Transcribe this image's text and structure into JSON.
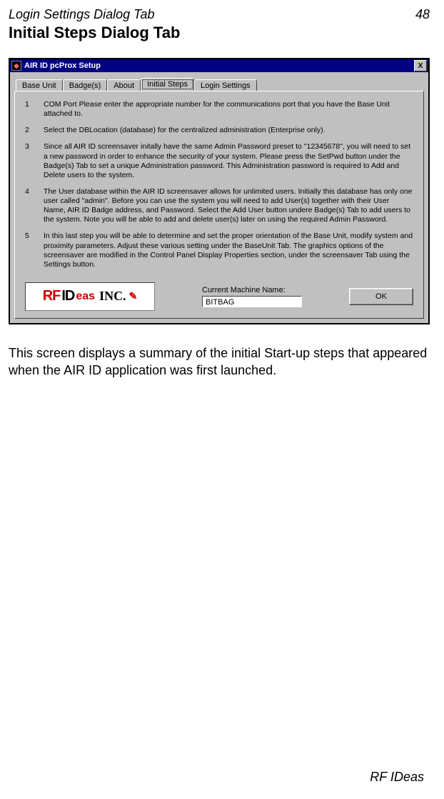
{
  "header": {
    "left": "Login Settings Dialog Tab",
    "right": "48"
  },
  "title": "Initial Steps Dialog Tab",
  "window": {
    "title": "AIR ID pcProx Setup",
    "close_glyph": "X",
    "tabs": [
      {
        "label": "Base Unit"
      },
      {
        "label": "Badge(s)"
      },
      {
        "label": "About"
      },
      {
        "label": "Initial Steps"
      },
      {
        "label": "Login Settings"
      }
    ],
    "active_tab_index": 3,
    "steps": [
      {
        "n": "1",
        "text": "COM Port   Please enter the appropriate number for the communications port that you have the Base Unit attached to."
      },
      {
        "n": "2",
        "text": "Select the DBLocation (database) for the centralized administration (Enterprise only)."
      },
      {
        "n": "3",
        "text": "Since all AIR ID screensaver initally have the same Admin Password preset to \"12345678\", you will need to set a new password in order to enhance the security of your system.  Please press the SetPwd button under the Badge(s) Tab to set a unique Administration password.  This Administration password is required to Add and Delete users to the system."
      },
      {
        "n": "4",
        "text": "The User database within the AIR ID screensaver allows for unlimited users.  Initially this database has only one user called \"admin\".  Before you can use the system you will need to add User(s) together with their User Name, AIR ID Badge address, and Password.  Select the Add User button undere Badge(s) Tab to add users to the system.  Note you will be able to add and delete user(s) later on using the required Admin Password."
      },
      {
        "n": "5",
        "text": "In this last step you will be able to determine and set the proper orientation of the Base Unit, modify system and proximity parameters.  Adjust these various setting under the BaseUnit Tab. The graphics options of the screensaver are modified in the Control Panel Display Properties section, under  the screensaver Tab using the Settings button."
      }
    ],
    "machine_label": "Current Machine Name:",
    "machine_value": "BITBAG",
    "ok_label": "OK",
    "logo": {
      "rf": "RF",
      "id": "ID",
      "eas": "eas",
      "inc": "INC.",
      "swoosh": "✎"
    }
  },
  "body_text": "This screen displays a summary of the initial Start-up steps that appeared when the AIR ID application was first launched.",
  "footer": "RF IDeas"
}
